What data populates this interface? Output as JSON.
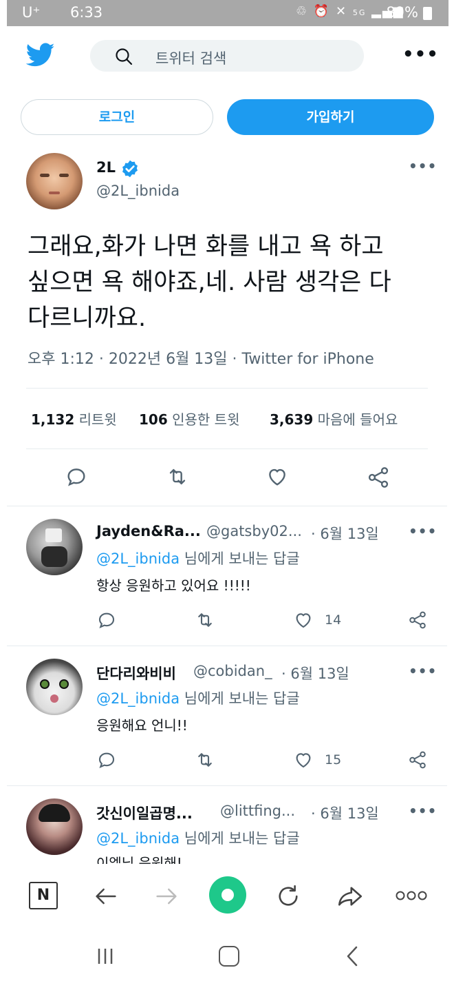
{
  "status_bar": {
    "carrier": "U⁺",
    "time": "6:33",
    "icons": [
      "battery-saver-icon",
      "alarm-icon",
      "mute-icon",
      "5g-icon",
      "signal-icon"
    ],
    "network": "5G",
    "battery": "89%"
  },
  "header": {
    "search_placeholder": "트위터 검색",
    "more_label": "•••"
  },
  "auth": {
    "login_label": "로그인",
    "signup_label": "가입하기"
  },
  "tweet": {
    "author_name": "2L",
    "author_handle": "@2L_ibnida",
    "verified": true,
    "text_lines": [
      "그래요,화가 나면 화를 내고 욕 하고",
      "싶으면 욕 해야죠,네. 사람 생각은 다",
      "다르니까요."
    ],
    "meta": "오후 1:12 · 2022년 6월 13일 · Twitter for iPhone",
    "retweets_count": "1,132",
    "retweets_label": "리트윗",
    "quotes_count": "106",
    "quotes_label": "인용한 트윗",
    "likes_count": "3,639",
    "likes_label": "마음에 들어요"
  },
  "replies": [
    {
      "name": "Jayden&Ra...",
      "handle": "@gatsby02...",
      "date": "· 6월 13일",
      "reply_to_mention": "@2L_ibnida",
      "reply_to_suffix": " 님에게 보내는 답글",
      "text": "항상 응원하고 있어요 !!!!!",
      "like_count": "14"
    },
    {
      "name": "단다리와비비",
      "handle": "@cobidan_",
      "date": "· 6월 13일",
      "reply_to_mention": "@2L_ibnida",
      "reply_to_suffix": " 님에게 보내는 답글",
      "text": "응원해요 언니!!",
      "like_count": "15"
    },
    {
      "name": "갓신이일곱명...",
      "handle": "@littfing...",
      "date": "· 6월 13일",
      "reply_to_mention": "@2L_ibnida",
      "reply_to_suffix": " 님에게 보내는 답글",
      "text": "이엘님 응원해!",
      "like_count": ""
    }
  ],
  "browser_bar": {
    "naver_label": "N"
  },
  "colors": {
    "accent": "#1d9bf0",
    "text": "#0f1419",
    "muted": "#536471",
    "divider": "#e6ecef",
    "status_bar": "#a8a8a8",
    "browser_green": "#1ec88a"
  }
}
